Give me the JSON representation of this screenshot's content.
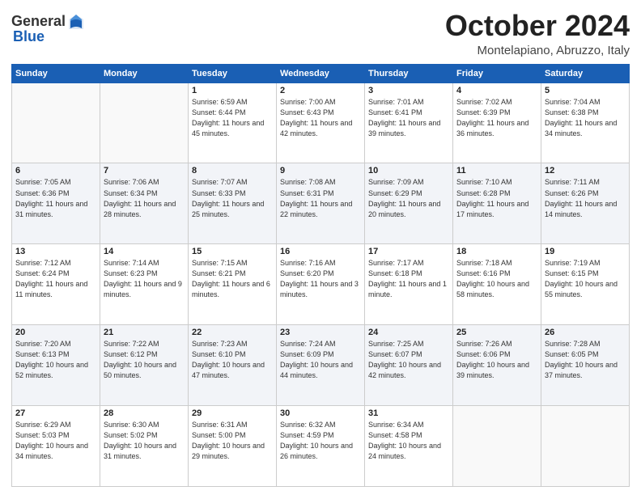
{
  "header": {
    "logo_general": "General",
    "logo_blue": "Blue",
    "month": "October 2024",
    "location": "Montelapiano, Abruzzo, Italy"
  },
  "weekdays": [
    "Sunday",
    "Monday",
    "Tuesday",
    "Wednesday",
    "Thursday",
    "Friday",
    "Saturday"
  ],
  "weeks": [
    [
      {
        "day": "",
        "sunrise": "",
        "sunset": "",
        "daylight": ""
      },
      {
        "day": "",
        "sunrise": "",
        "sunset": "",
        "daylight": ""
      },
      {
        "day": "1",
        "sunrise": "Sunrise: 6:59 AM",
        "sunset": "Sunset: 6:44 PM",
        "daylight": "Daylight: 11 hours and 45 minutes."
      },
      {
        "day": "2",
        "sunrise": "Sunrise: 7:00 AM",
        "sunset": "Sunset: 6:43 PM",
        "daylight": "Daylight: 11 hours and 42 minutes."
      },
      {
        "day": "3",
        "sunrise": "Sunrise: 7:01 AM",
        "sunset": "Sunset: 6:41 PM",
        "daylight": "Daylight: 11 hours and 39 minutes."
      },
      {
        "day": "4",
        "sunrise": "Sunrise: 7:02 AM",
        "sunset": "Sunset: 6:39 PM",
        "daylight": "Daylight: 11 hours and 36 minutes."
      },
      {
        "day": "5",
        "sunrise": "Sunrise: 7:04 AM",
        "sunset": "Sunset: 6:38 PM",
        "daylight": "Daylight: 11 hours and 34 minutes."
      }
    ],
    [
      {
        "day": "6",
        "sunrise": "Sunrise: 7:05 AM",
        "sunset": "Sunset: 6:36 PM",
        "daylight": "Daylight: 11 hours and 31 minutes."
      },
      {
        "day": "7",
        "sunrise": "Sunrise: 7:06 AM",
        "sunset": "Sunset: 6:34 PM",
        "daylight": "Daylight: 11 hours and 28 minutes."
      },
      {
        "day": "8",
        "sunrise": "Sunrise: 7:07 AM",
        "sunset": "Sunset: 6:33 PM",
        "daylight": "Daylight: 11 hours and 25 minutes."
      },
      {
        "day": "9",
        "sunrise": "Sunrise: 7:08 AM",
        "sunset": "Sunset: 6:31 PM",
        "daylight": "Daylight: 11 hours and 22 minutes."
      },
      {
        "day": "10",
        "sunrise": "Sunrise: 7:09 AM",
        "sunset": "Sunset: 6:29 PM",
        "daylight": "Daylight: 11 hours and 20 minutes."
      },
      {
        "day": "11",
        "sunrise": "Sunrise: 7:10 AM",
        "sunset": "Sunset: 6:28 PM",
        "daylight": "Daylight: 11 hours and 17 minutes."
      },
      {
        "day": "12",
        "sunrise": "Sunrise: 7:11 AM",
        "sunset": "Sunset: 6:26 PM",
        "daylight": "Daylight: 11 hours and 14 minutes."
      }
    ],
    [
      {
        "day": "13",
        "sunrise": "Sunrise: 7:12 AM",
        "sunset": "Sunset: 6:24 PM",
        "daylight": "Daylight: 11 hours and 11 minutes."
      },
      {
        "day": "14",
        "sunrise": "Sunrise: 7:14 AM",
        "sunset": "Sunset: 6:23 PM",
        "daylight": "Daylight: 11 hours and 9 minutes."
      },
      {
        "day": "15",
        "sunrise": "Sunrise: 7:15 AM",
        "sunset": "Sunset: 6:21 PM",
        "daylight": "Daylight: 11 hours and 6 minutes."
      },
      {
        "day": "16",
        "sunrise": "Sunrise: 7:16 AM",
        "sunset": "Sunset: 6:20 PM",
        "daylight": "Daylight: 11 hours and 3 minutes."
      },
      {
        "day": "17",
        "sunrise": "Sunrise: 7:17 AM",
        "sunset": "Sunset: 6:18 PM",
        "daylight": "Daylight: 11 hours and 1 minute."
      },
      {
        "day": "18",
        "sunrise": "Sunrise: 7:18 AM",
        "sunset": "Sunset: 6:16 PM",
        "daylight": "Daylight: 10 hours and 58 minutes."
      },
      {
        "day": "19",
        "sunrise": "Sunrise: 7:19 AM",
        "sunset": "Sunset: 6:15 PM",
        "daylight": "Daylight: 10 hours and 55 minutes."
      }
    ],
    [
      {
        "day": "20",
        "sunrise": "Sunrise: 7:20 AM",
        "sunset": "Sunset: 6:13 PM",
        "daylight": "Daylight: 10 hours and 52 minutes."
      },
      {
        "day": "21",
        "sunrise": "Sunrise: 7:22 AM",
        "sunset": "Sunset: 6:12 PM",
        "daylight": "Daylight: 10 hours and 50 minutes."
      },
      {
        "day": "22",
        "sunrise": "Sunrise: 7:23 AM",
        "sunset": "Sunset: 6:10 PM",
        "daylight": "Daylight: 10 hours and 47 minutes."
      },
      {
        "day": "23",
        "sunrise": "Sunrise: 7:24 AM",
        "sunset": "Sunset: 6:09 PM",
        "daylight": "Daylight: 10 hours and 44 minutes."
      },
      {
        "day": "24",
        "sunrise": "Sunrise: 7:25 AM",
        "sunset": "Sunset: 6:07 PM",
        "daylight": "Daylight: 10 hours and 42 minutes."
      },
      {
        "day": "25",
        "sunrise": "Sunrise: 7:26 AM",
        "sunset": "Sunset: 6:06 PM",
        "daylight": "Daylight: 10 hours and 39 minutes."
      },
      {
        "day": "26",
        "sunrise": "Sunrise: 7:28 AM",
        "sunset": "Sunset: 6:05 PM",
        "daylight": "Daylight: 10 hours and 37 minutes."
      }
    ],
    [
      {
        "day": "27",
        "sunrise": "Sunrise: 6:29 AM",
        "sunset": "Sunset: 5:03 PM",
        "daylight": "Daylight: 10 hours and 34 minutes."
      },
      {
        "day": "28",
        "sunrise": "Sunrise: 6:30 AM",
        "sunset": "Sunset: 5:02 PM",
        "daylight": "Daylight: 10 hours and 31 minutes."
      },
      {
        "day": "29",
        "sunrise": "Sunrise: 6:31 AM",
        "sunset": "Sunset: 5:00 PM",
        "daylight": "Daylight: 10 hours and 29 minutes."
      },
      {
        "day": "30",
        "sunrise": "Sunrise: 6:32 AM",
        "sunset": "Sunset: 4:59 PM",
        "daylight": "Daylight: 10 hours and 26 minutes."
      },
      {
        "day": "31",
        "sunrise": "Sunrise: 6:34 AM",
        "sunset": "Sunset: 4:58 PM",
        "daylight": "Daylight: 10 hours and 24 minutes."
      },
      {
        "day": "",
        "sunrise": "",
        "sunset": "",
        "daylight": ""
      },
      {
        "day": "",
        "sunrise": "",
        "sunset": "",
        "daylight": ""
      }
    ]
  ]
}
